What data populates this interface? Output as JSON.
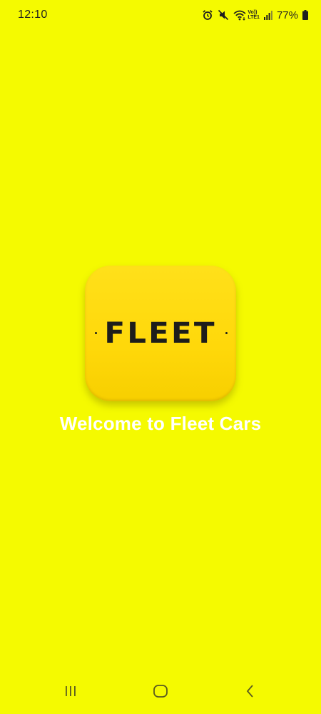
{
  "status_bar": {
    "time": "12:10",
    "volte_line1": "Vo))",
    "volte_line2": "LTE1",
    "battery_percent": "77%",
    "icons": [
      "alarm-icon",
      "mute-icon",
      "wifi-icon",
      "signal-icon",
      "battery-icon"
    ]
  },
  "splash": {
    "logo_text": "FLEET",
    "welcome_text": "Welcome to Fleet Cars"
  },
  "colors": {
    "background": "#f5fa00",
    "logo_bg": "#ffdc0f",
    "logo_text": "#1d1d1b",
    "welcome_text": "#ffffff"
  },
  "nav_bar": {
    "buttons": [
      "recents-icon",
      "home-icon",
      "back-icon"
    ]
  }
}
